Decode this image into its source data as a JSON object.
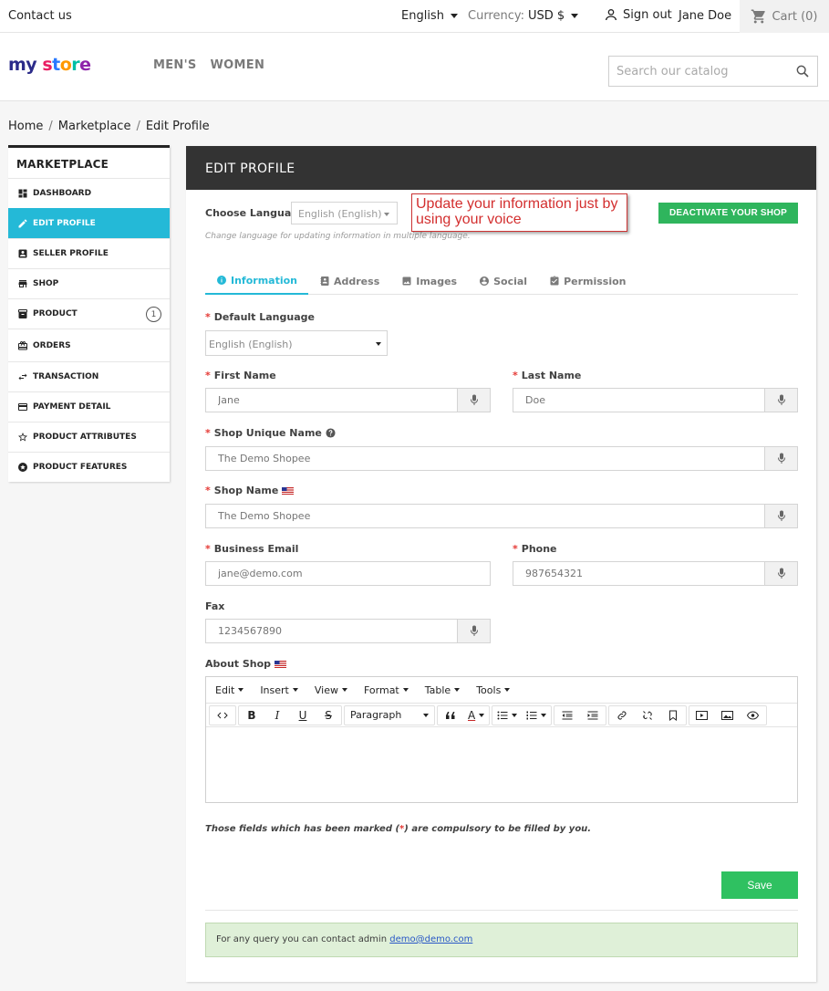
{
  "topbar": {
    "contact": "Contact us",
    "language": "English",
    "currency_label": "Currency:",
    "currency_value": "USD $",
    "sign_out": "Sign out",
    "username": "Jane Doe",
    "cart": "Cart (0)"
  },
  "header": {
    "logo": {
      "my": "my",
      "s": "s",
      "t": "t",
      "o": "o",
      "r": "r",
      "e": "e"
    },
    "nav": [
      "MEN'S",
      "WOMEN"
    ],
    "search_placeholder": "Search our catalog"
  },
  "breadcrumb": [
    "Home",
    "Marketplace",
    "Edit Profile"
  ],
  "sidebar": {
    "title": "MARKETPLACE",
    "items": [
      {
        "label": "Dashboard",
        "icon": "dashboard-icon"
      },
      {
        "label": "Edit Profile",
        "icon": "pencil-icon",
        "active": true
      },
      {
        "label": "Seller Profile",
        "icon": "contact-card-icon"
      },
      {
        "label": "Shop",
        "icon": "store-icon"
      },
      {
        "label": "Product",
        "icon": "archive-icon",
        "badge": "1"
      },
      {
        "label": "Orders",
        "icon": "gift-icon"
      },
      {
        "label": "Transaction",
        "icon": "swap-icon"
      },
      {
        "label": "Payment Detail",
        "icon": "credit-card-icon"
      },
      {
        "label": "Product Attributes",
        "icon": "star-outline-icon"
      },
      {
        "label": "Product Features",
        "icon": "star-circle-icon"
      }
    ]
  },
  "panel": {
    "title": "EDIT PROFILE",
    "choose_language_label": "Choose Language",
    "choose_language_value": "English (English)",
    "language_help": "Change language for updating information in multiple language.",
    "voice_note": "Update your information just by using your voice",
    "deactivate_label": "DEACTIVATE YOUR SHOP",
    "tabs": [
      {
        "label": "Information",
        "icon": "info-icon",
        "active": true
      },
      {
        "label": "Address",
        "icon": "address-book-icon"
      },
      {
        "label": "Images",
        "icon": "image-icon"
      },
      {
        "label": "Social",
        "icon": "account-circle-icon"
      },
      {
        "label": "Permission",
        "icon": "clipboard-check-icon"
      }
    ],
    "required_mark": "*",
    "fields": {
      "default_language": {
        "label": "Default Language",
        "value": "English (English)"
      },
      "first_name": {
        "label": "First Name",
        "placeholder": "Jane"
      },
      "last_name": {
        "label": "Last Name",
        "placeholder": "Doe"
      },
      "shop_unique_name": {
        "label": "Shop Unique Name",
        "placeholder": "The Demo Shopee"
      },
      "shop_name": {
        "label": "Shop Name",
        "placeholder": "The Demo Shopee"
      },
      "business_email": {
        "label": "Business Email",
        "placeholder": "jane@demo.com"
      },
      "phone": {
        "label": "Phone",
        "placeholder": "987654321"
      },
      "fax": {
        "label": "Fax",
        "placeholder": "1234567890"
      },
      "about_shop": {
        "label": "About Shop"
      }
    },
    "editor": {
      "menus": [
        "Edit",
        "Insert",
        "View",
        "Format",
        "Table",
        "Tools"
      ],
      "paragraph": "Paragraph",
      "bold": "B",
      "italic": "I",
      "underline": "U",
      "strike": "S",
      "font_color": "A"
    },
    "compulsory_note": {
      "before": "Those fields which has been marked (",
      "star": "*",
      "after": ") are compulsory to be filled by you."
    },
    "save_label": "Save",
    "notice_text": "For any query you can contact admin ",
    "notice_email": "demo@demo.com"
  }
}
